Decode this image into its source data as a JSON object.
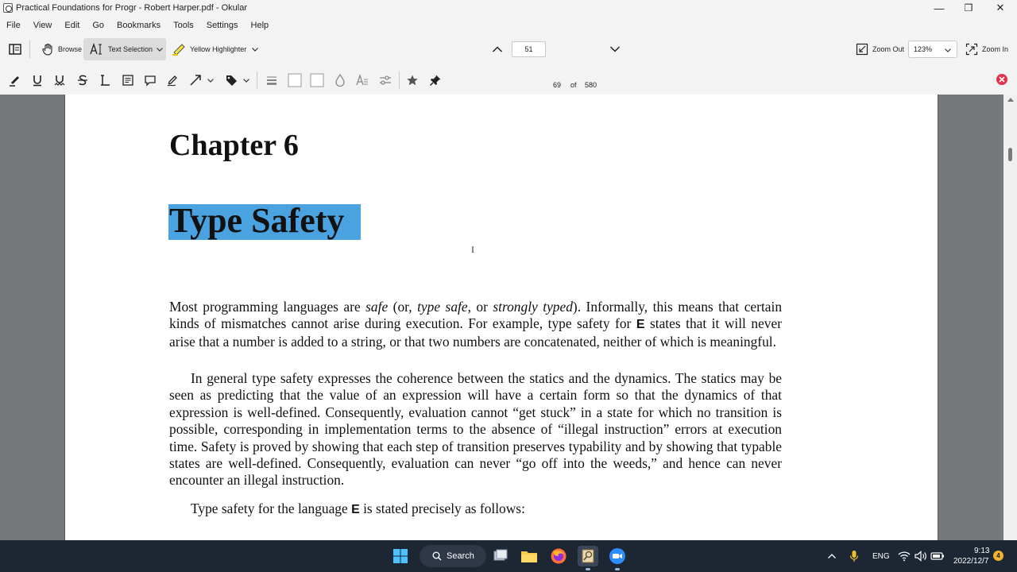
{
  "window": {
    "title": "Practical Foundations for Progr - Robert Harper.pdf  - Okular",
    "controls": {
      "minimize": "—",
      "maximize": "❐",
      "close": "✕"
    }
  },
  "menubar": {
    "items": [
      "File",
      "View",
      "Edit",
      "Go",
      "Bookmarks",
      "Tools",
      "Settings",
      "Help"
    ]
  },
  "toolbar": {
    "browse_label": "Browse",
    "text_selection_label": "Text Selection",
    "highlighter_label": "Yellow Highlighter",
    "page_input_value": "51",
    "page_label_number": "69",
    "of_label": "of",
    "total_pages": "580",
    "zoom_out_label": "Zoom Out",
    "zoom_value": "123%",
    "zoom_in_label": "Zoom In"
  },
  "document": {
    "chapter_heading": "Chapter 6",
    "section_title": "Type Safety",
    "para1": {
      "t1": "Most programming languages are ",
      "i1": "safe",
      "t2": " (or, ",
      "i2": "type safe",
      "t3": ", or ",
      "i3": "strongly typed",
      "t4": ").  Informally, this means that certain kinds of mismatches cannot arise during execution.  For example, type safety for ",
      "b1": "E",
      "t5": " states that it will never arise that a number is added to a string, or that two numbers are concatenated, neither of which is meaningful."
    },
    "para2": "In general type safety expresses the coherence between the statics and the dynamics. The statics may be seen as predicting that the value of an expression will have a certain form so that the dynamics of that expression is well-defined.  Consequently, evaluation cannot “get stuck” in a state for which no transition is possible, corresponding in implementation terms to the absence of “illegal instruction” errors at execution time.  Safety is proved by showing that each step of transition preserves typability and by showing that typable states are well-defined. Consequently, evaluation can never “go off into the weeds,” and hence can never encounter an illegal instruction.",
    "para3": {
      "t1": "Type safety for the language ",
      "b1": "E",
      "t2": " is stated precisely as follows:"
    }
  },
  "taskbar": {
    "search_label": "Search",
    "language": "ENG",
    "time": "9:13",
    "date": "2022/12/7",
    "notification_count": "4"
  },
  "colors": {
    "selection": "#4aa3e0",
    "taskbar": "#1d2633",
    "close_annotations": "#e0334c",
    "highlighter": "#f5e04a"
  }
}
